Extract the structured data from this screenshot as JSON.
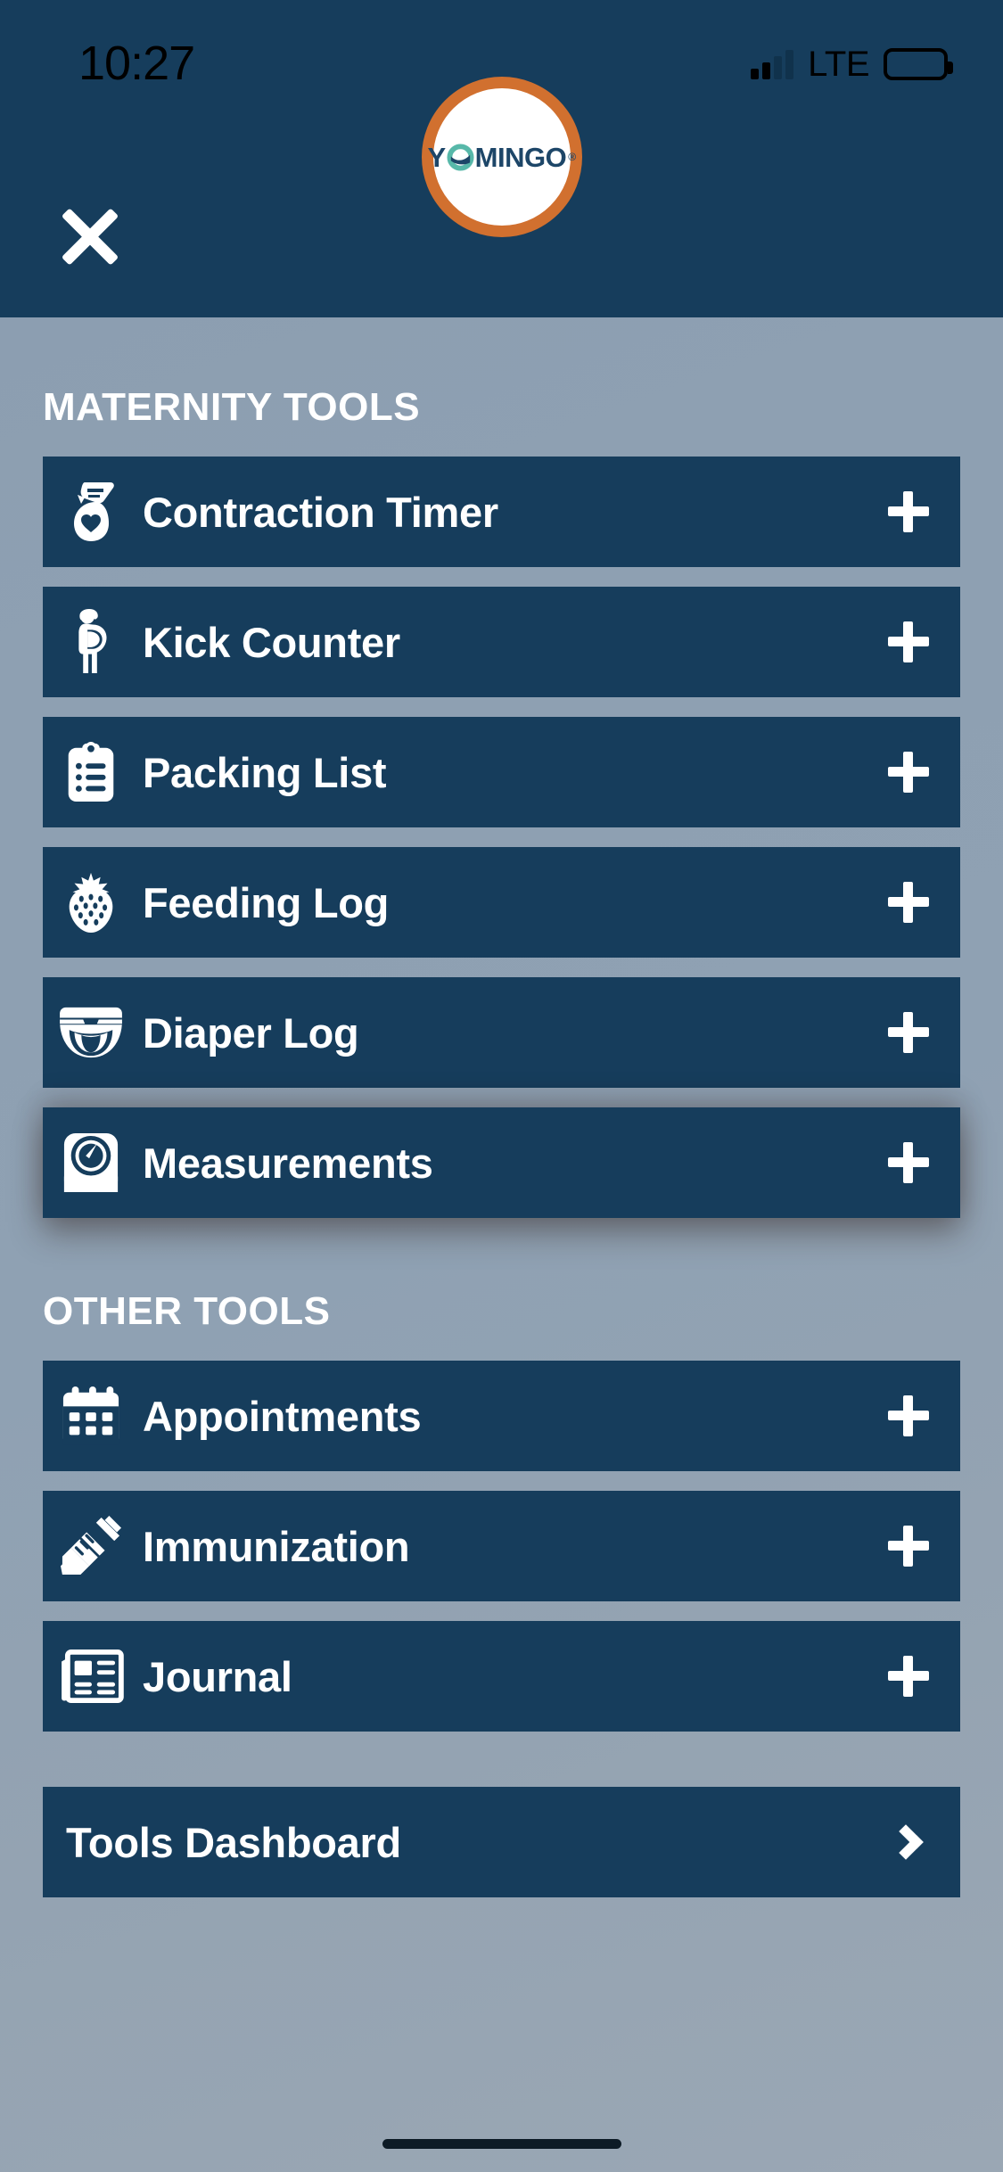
{
  "status_bar": {
    "time": "10:27",
    "network": "LTE",
    "signal_icon": "signal-bars-icon",
    "battery_icon": "battery-full-icon"
  },
  "header": {
    "close_icon": "close-icon",
    "logo": {
      "name": "yomingo-logo",
      "text_before": "Y",
      "text_after": "MINGO",
      "trademark": "®",
      "ring_color": "#d1702f",
      "text_color": "#1d4668",
      "accent_color": "#57b8a9"
    }
  },
  "theme": {
    "header_bg": "#163d5c",
    "row_bg": "#163d5c",
    "page_bg": "#8fa1b3",
    "accent_orange": "#d1702f",
    "text_light": "#ffffff"
  },
  "sections": [
    {
      "title": "MATERNITY TOOLS",
      "items": [
        {
          "label": "Contraction Timer",
          "icon": "pregnant-woman-clipboard-icon",
          "action_icon": "plus-icon",
          "elevated": false
        },
        {
          "label": "Kick Counter",
          "icon": "pregnant-woman-icon",
          "action_icon": "plus-icon",
          "elevated": false
        },
        {
          "label": "Packing List",
          "icon": "clipboard-list-icon",
          "action_icon": "plus-icon",
          "elevated": false
        },
        {
          "label": "Feeding Log",
          "icon": "strawberry-icon",
          "action_icon": "plus-icon",
          "elevated": false
        },
        {
          "label": "Diaper Log",
          "icon": "diaper-icon",
          "action_icon": "plus-icon",
          "elevated": false
        },
        {
          "label": "Measurements",
          "icon": "weight-scale-icon",
          "action_icon": "plus-icon",
          "elevated": true
        }
      ]
    },
    {
      "title": "OTHER TOOLS",
      "items": [
        {
          "label": "Appointments",
          "icon": "calendar-icon",
          "action_icon": "plus-icon",
          "elevated": false
        },
        {
          "label": "Immunization",
          "icon": "syringe-icon",
          "action_icon": "plus-icon",
          "elevated": false
        },
        {
          "label": "Journal",
          "icon": "newspaper-icon",
          "action_icon": "plus-icon",
          "elevated": false
        }
      ]
    }
  ],
  "dashboard": {
    "label": "Tools Dashboard",
    "action_icon": "chevron-right-icon"
  },
  "home_indicator": "home-indicator"
}
